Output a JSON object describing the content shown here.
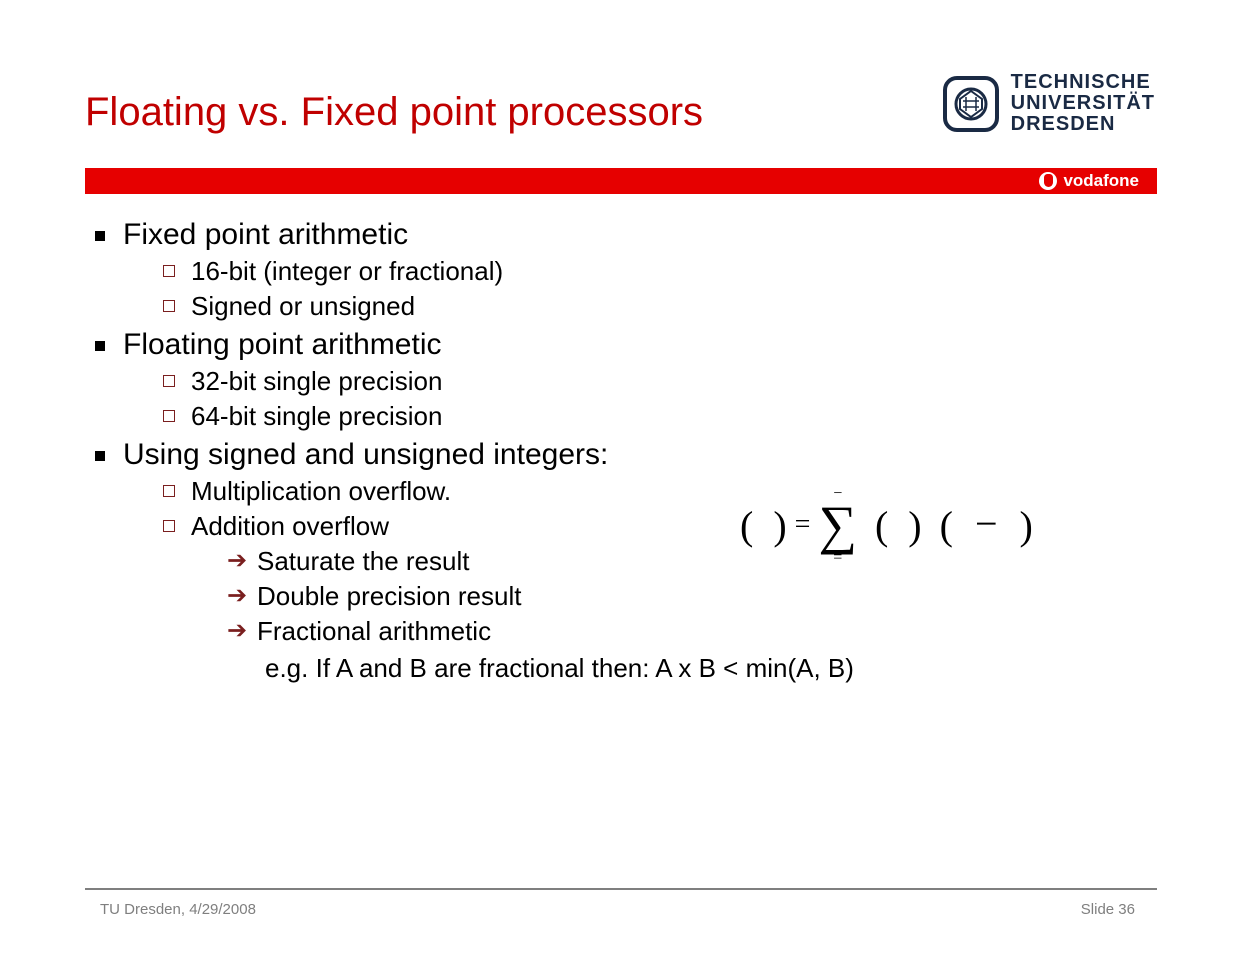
{
  "title": "Floating vs. Fixed point processors",
  "logo": {
    "line1": "TECHNISCHE",
    "line2": "UNIVERSITÄT",
    "line3": "DRESDEN"
  },
  "sponsor": {
    "label": "vodafone"
  },
  "bullets": [
    {
      "text": "Fixed point arithmetic",
      "sub": [
        {
          "text": "16-bit (integer or fractional)"
        },
        {
          "text": "Signed or unsigned"
        }
      ]
    },
    {
      "text": "Floating point arithmetic",
      "sub": [
        {
          "text": "32-bit single precision"
        },
        {
          "text": "64-bit single precision"
        }
      ]
    },
    {
      "text": "Using signed and unsigned integers:",
      "sub": [
        {
          "text": "Multiplication overflow."
        },
        {
          "text": "Addition overflow",
          "sub": [
            {
              "text": "Saturate the result"
            },
            {
              "text": "Double precision result"
            },
            {
              "text": "Fractional arithmetic"
            }
          ]
        }
      ]
    }
  ],
  "example_line": "e.g. If A and B are fractional then: A x B < min(A, B)",
  "formula": {
    "lp1": "(",
    "rp1": ")",
    "eq": "=",
    "sigma_top": "−",
    "sigma_bot": "=",
    "lp2": "(",
    "rp2": ")",
    "lp3": "(",
    "minus": "−",
    "rp3": ")"
  },
  "footer": {
    "left": "TU Dresden, 4/29/2008",
    "right": "Slide 36"
  }
}
